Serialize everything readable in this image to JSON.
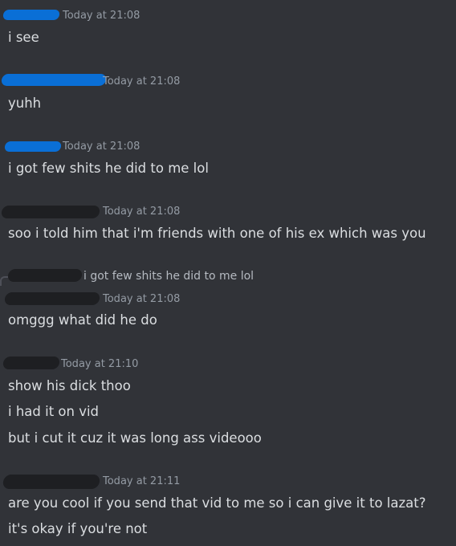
{
  "messages": [
    {
      "timestamp": "Today at 21:08",
      "lines": [
        "i see"
      ]
    },
    {
      "timestamp": "Today at 21:08",
      "lines": [
        "yuhh"
      ]
    },
    {
      "timestamp": "Today at 21:08",
      "lines": [
        "i got few shits he did to me lol"
      ]
    },
    {
      "timestamp": "Today at 21:08",
      "lines": [
        "soo i told him that i'm friends with one of his ex which was you"
      ]
    },
    {
      "reply_preview": "i got few shits he did to me lol",
      "timestamp": "Today at 21:08",
      "lines": [
        "omggg what did he do"
      ]
    },
    {
      "timestamp": "Today at 21:10",
      "lines": [
        "show his dick thoo",
        "i had it on vid",
        "but i cut it cuz it was long ass videooo"
      ]
    },
    {
      "timestamp": "Today at 21:11",
      "lines": [
        "are you cool if you send that vid to me so i can give it to lazat?",
        "it's okay if you're not"
      ]
    }
  ],
  "colors": {
    "background": "#313338",
    "text": "#dbdee1",
    "timestamp": "#949ba4",
    "redaction_blue": "#0a6fd6",
    "redaction_dark": "#1e1f22"
  }
}
